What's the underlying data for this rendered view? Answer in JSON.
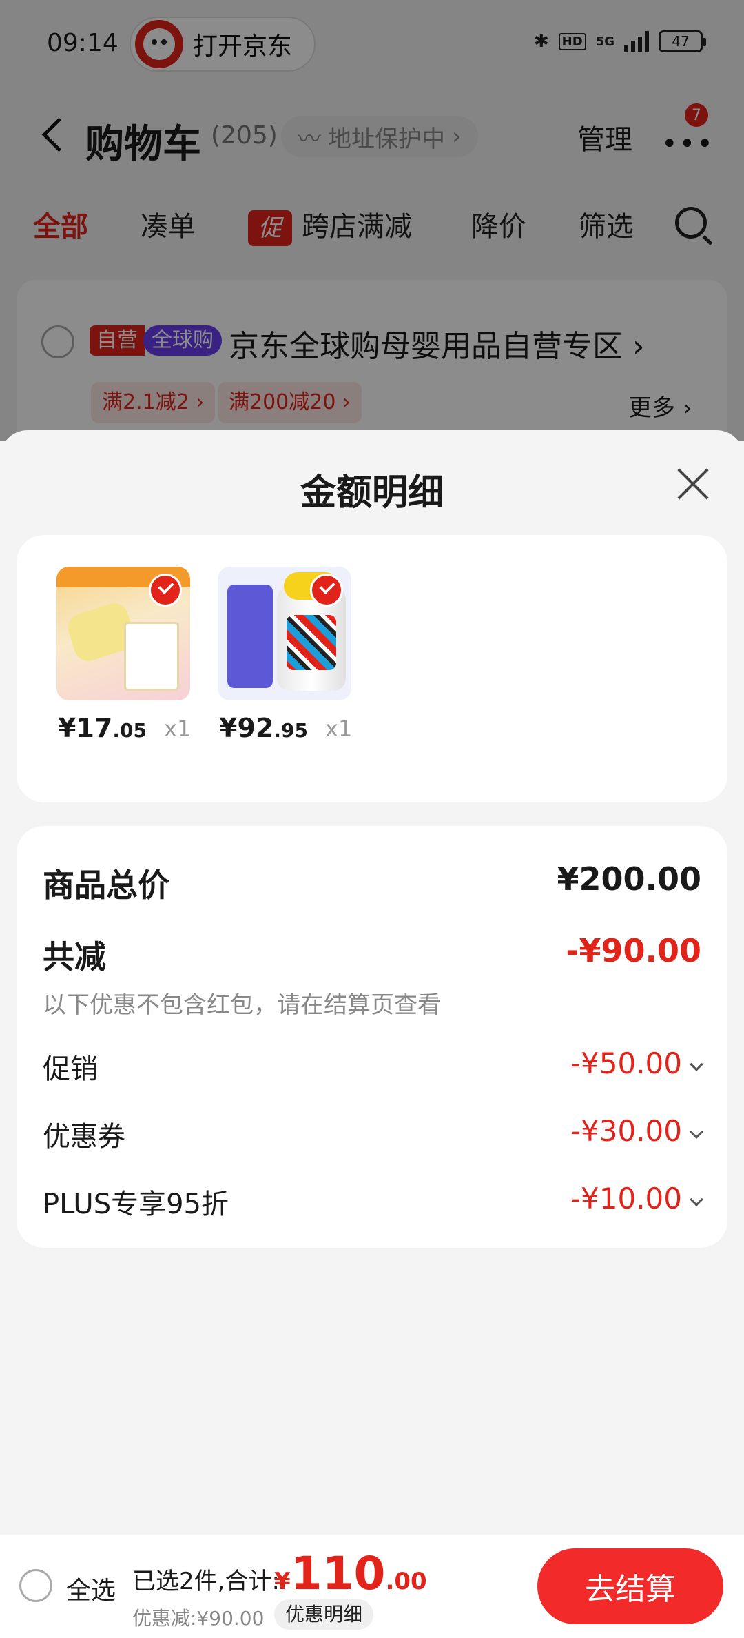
{
  "status_bar": {
    "time": "09:14",
    "open_app": "打开京东",
    "network": "5G",
    "hd": "HD",
    "battery": "47"
  },
  "header": {
    "title": "购物车",
    "count": "(205)",
    "address": "地址保护中",
    "manage": "管理",
    "more": "•••",
    "badge": "7"
  },
  "tabs": [
    {
      "label": "全部",
      "active": true
    },
    {
      "label": "凑单"
    },
    {
      "label": "跨店满减",
      "promo_icon": "促"
    },
    {
      "label": "降价"
    },
    {
      "label": "筛选"
    }
  ],
  "shop": {
    "tag_self": "自营",
    "tag_global": "全球购",
    "name": "京东全球购母婴用品自营专区",
    "promos": [
      "满2.1减2 ›",
      "满200减20 ›"
    ],
    "more": "更多 ›"
  },
  "sheet": {
    "title": "金额明细",
    "products": [
      {
        "price_int": "¥17",
        "price_dec": ".05",
        "qty": "x1"
      },
      {
        "price_int": "¥92",
        "price_dec": ".95",
        "qty": "x1"
      }
    ],
    "summary": {
      "total_label": "商品总价",
      "total_value": "¥200.00",
      "reduce_label": "共减",
      "reduce_value": "-¥90.00",
      "note": "以下优惠不包含红包，请在结算页查看",
      "items": [
        {
          "label": "促销",
          "value": "-¥50.00"
        },
        {
          "label": "优惠券",
          "value": "-¥30.00"
        },
        {
          "label": "PLUS专享95折",
          "value": "-¥10.00"
        }
      ]
    }
  },
  "bottom": {
    "select_all": "全选",
    "selected": "已选2件,合计:",
    "currency": "¥",
    "total_int": "110",
    "total_dec": ".00",
    "discount": "优惠减:¥90.00",
    "detail_button": "优惠明细",
    "checkout": "去结算"
  },
  "colors": {
    "accent": "#e2231a",
    "global_tag": "#6a3df0"
  }
}
